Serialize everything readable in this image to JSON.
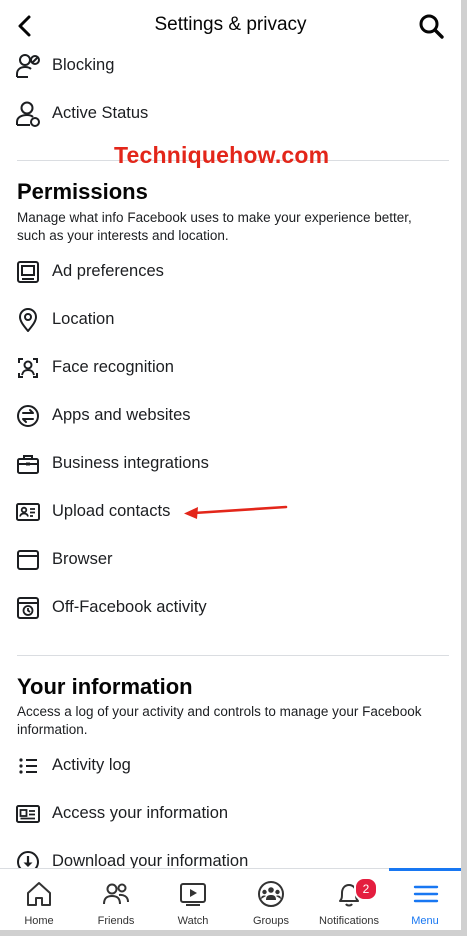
{
  "header": {
    "title": "Settings & privacy"
  },
  "watermark": "Techniquehow.com",
  "top_items": [
    {
      "label": "Blocking",
      "icon": "blocking-icon"
    },
    {
      "label": "Active Status",
      "icon": "active-status-icon"
    }
  ],
  "permissions": {
    "title": "Permissions",
    "description": "Manage what info Facebook uses to make your experience better, such as your interests and location.",
    "items": [
      {
        "label": "Ad preferences",
        "icon": "ad-preferences-icon"
      },
      {
        "label": "Location",
        "icon": "location-pin-icon"
      },
      {
        "label": "Face recognition",
        "icon": "face-recognition-icon"
      },
      {
        "label": "Apps and websites",
        "icon": "apps-websites-icon"
      },
      {
        "label": "Business integrations",
        "icon": "briefcase-icon"
      },
      {
        "label": "Upload contacts",
        "icon": "contact-card-icon"
      },
      {
        "label": "Browser",
        "icon": "browser-window-icon"
      },
      {
        "label": "Off-Facebook activity",
        "icon": "off-facebook-activity-icon"
      }
    ]
  },
  "your_information": {
    "title": "Your information",
    "description": "Access a log of your activity and controls to manage your Facebook information.",
    "items": [
      {
        "label": "Activity log",
        "icon": "list-icon"
      },
      {
        "label": "Access your information",
        "icon": "id-card-icon"
      },
      {
        "label": "Download your information",
        "icon": "download-icon"
      }
    ]
  },
  "tabbar": {
    "tabs": [
      {
        "label": "Home",
        "icon": "home-icon"
      },
      {
        "label": "Friends",
        "icon": "friends-icon"
      },
      {
        "label": "Watch",
        "icon": "watch-icon"
      },
      {
        "label": "Groups",
        "icon": "groups-icon"
      },
      {
        "label": "Notifications",
        "icon": "bell-icon",
        "badge": "2"
      },
      {
        "label": "Menu",
        "icon": "hamburger-menu-icon",
        "active": true
      }
    ]
  },
  "colors": {
    "accent": "#1877f2",
    "badge": "#e41e3f",
    "annotation": "#e3261a"
  }
}
